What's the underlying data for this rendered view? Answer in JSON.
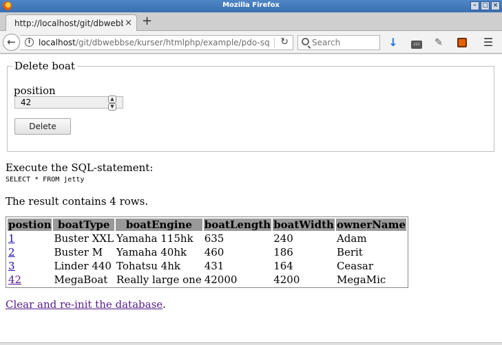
{
  "window": {
    "title": "Mozilla Firefox",
    "buttons": [
      "–",
      "□",
      "×"
    ]
  },
  "tab": {
    "title": "http://localhost/git/dbwebbse",
    "close": "×",
    "new_tab": "+"
  },
  "nav": {
    "back": "←",
    "url_host": "localhost",
    "url_prefix": "",
    "url_path": "/git/dbwebbse/kurser/htmlphp/example/pdo-sq",
    "reload": "↻",
    "search_placeholder": "Search",
    "menu": "☰"
  },
  "form": {
    "legend": "Delete boat",
    "position_label": "position",
    "position_value": "42",
    "delete_label": "Delete"
  },
  "execute_label": "Execute the SQL-statement:",
  "sql": "SELECT * FROM jetty",
  "result_text": "The result contains 4 rows.",
  "table": {
    "headers": [
      "postion",
      "boatType",
      "boatEngine",
      "boatLength",
      "boatWidth",
      "ownerName"
    ],
    "rows": [
      [
        "1",
        "Buster XXL",
        "Yamaha 115hk",
        "635",
        "240",
        "Adam"
      ],
      [
        "2",
        "Buster M",
        "Yamaha 40hk",
        "460",
        "186",
        "Berit"
      ],
      [
        "3",
        "Linder 440",
        "Tohatsu 4hk",
        "431",
        "164",
        "Ceasar"
      ],
      [
        "42",
        "MegaBoat",
        "Really large one",
        "42000",
        "4200",
        "MegaMic"
      ]
    ]
  },
  "clear_link": "Clear and re-init the database",
  "clear_suffix": "."
}
